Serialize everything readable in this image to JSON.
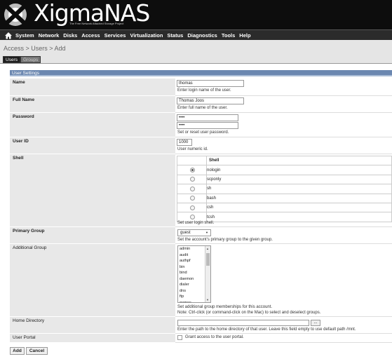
{
  "header": {
    "logo_text": "XigmaNAS",
    "logo_subtitle": "The Free Network Attached Storage Project"
  },
  "nav": {
    "home_icon": "home-icon",
    "items": [
      "System",
      "Network",
      "Disks",
      "Access",
      "Services",
      "Virtualization",
      "Status",
      "Diagnostics",
      "Tools",
      "Help"
    ]
  },
  "breadcrumb": "Access > Users > Add",
  "tabs": [
    "Users",
    "Groups"
  ],
  "section_title": "User Settings",
  "form": {
    "name": {
      "label": "Name",
      "value": "thomas",
      "desc": "Enter login name of the user."
    },
    "full_name": {
      "label": "Full Name",
      "value": "Thomas Joos",
      "desc": "Enter full name of the user."
    },
    "password": {
      "label": "Password",
      "value": "••••",
      "confirm": "••••",
      "desc": "Set or reset user password."
    },
    "user_id": {
      "label": "User ID",
      "value": "1000",
      "desc": "User numeric id."
    },
    "shell": {
      "label": "Shell",
      "column_header": "Shell",
      "options": [
        "nologin",
        "scponly",
        "sh",
        "bash",
        "csh",
        "tcsh"
      ],
      "selected": "nologin",
      "desc": "Set user login shell."
    },
    "primary_group": {
      "label": "Primary Group",
      "value": "guest",
      "desc": "Set the account's primary group to the given group."
    },
    "additional_group": {
      "label": "Additional Group",
      "options": [
        "admin",
        "audit",
        "authpf",
        "bin",
        "bind",
        "daemon",
        "dialer",
        "dns",
        "ftp",
        "games"
      ],
      "desc1": "Set additional group memberships for this account.",
      "desc2": "Note: Ctrl-click (or command-click on the Mac) to select and deselect groups."
    },
    "home_directory": {
      "label": "Home Directory",
      "value": "",
      "browse_label": "...",
      "desc": "Enter the path to the home directory of that user. Leave this field empty to use default path /mnt."
    },
    "user_portal": {
      "label": "User Portal",
      "checked": false,
      "desc": "Grant access to the user portal."
    }
  },
  "buttons": {
    "add": "Add",
    "cancel": "Cancel"
  }
}
